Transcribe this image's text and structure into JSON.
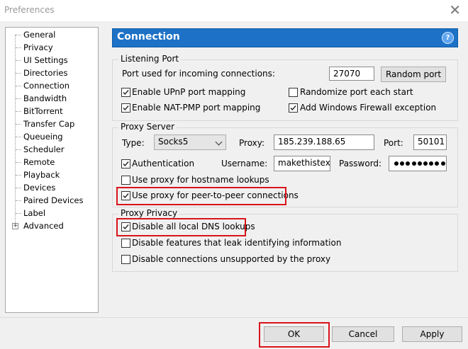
{
  "window": {
    "title": "Preferences"
  },
  "sidebar": {
    "items": [
      {
        "label": "General"
      },
      {
        "label": "Privacy"
      },
      {
        "label": "UI Settings"
      },
      {
        "label": "Directories"
      },
      {
        "label": "Connection"
      },
      {
        "label": "Bandwidth"
      },
      {
        "label": "BitTorrent"
      },
      {
        "label": "Transfer Cap"
      },
      {
        "label": "Queueing"
      },
      {
        "label": "Scheduler"
      },
      {
        "label": "Remote"
      },
      {
        "label": "Playback"
      },
      {
        "label": "Devices"
      },
      {
        "label": "Paired Devices"
      },
      {
        "label": "Label"
      },
      {
        "label": "Advanced"
      }
    ],
    "selected": "Connection"
  },
  "header": {
    "title": "Connection",
    "help_icon": "?"
  },
  "listening": {
    "title": "Listening Port",
    "port_label": "Port used for incoming connections:",
    "port_value": "27070",
    "random_port_button": "Random port",
    "upnp": {
      "label": "Enable UPnP port mapping",
      "checked": true
    },
    "randomize": {
      "label": "Randomize port each start",
      "checked": false
    },
    "natpmp": {
      "label": "Enable NAT-PMP port mapping",
      "checked": true
    },
    "firewall": {
      "label": "Add Windows Firewall exception",
      "checked": true
    }
  },
  "proxy": {
    "title": "Proxy Server",
    "type_label": "Type:",
    "type_value": "Socks5",
    "proxy_label": "Proxy:",
    "proxy_value": "185.239.188.65",
    "port_label": "Port:",
    "port_value": "50101",
    "auth": {
      "label": "Authentication",
      "checked": true
    },
    "username_label": "Username:",
    "username_value": "makethistext",
    "password_label": "Password:",
    "hostname": {
      "label": "Use proxy for hostname lookups",
      "checked": false
    },
    "p2p": {
      "label": "Use proxy for peer-to-peer connections",
      "checked": true
    }
  },
  "privacy": {
    "title": "Proxy Privacy",
    "dns": {
      "label": "Disable all local DNS lookups",
      "checked": true
    },
    "leak": {
      "label": "Disable features that leak identifying information",
      "checked": false
    },
    "unsupported": {
      "label": "Disable connections unsupported by the proxy",
      "checked": false
    }
  },
  "buttons": {
    "ok": "OK",
    "cancel": "Cancel",
    "apply": "Apply"
  },
  "colors": {
    "accent": "#1d71c6",
    "highlight": "#d9141b"
  }
}
